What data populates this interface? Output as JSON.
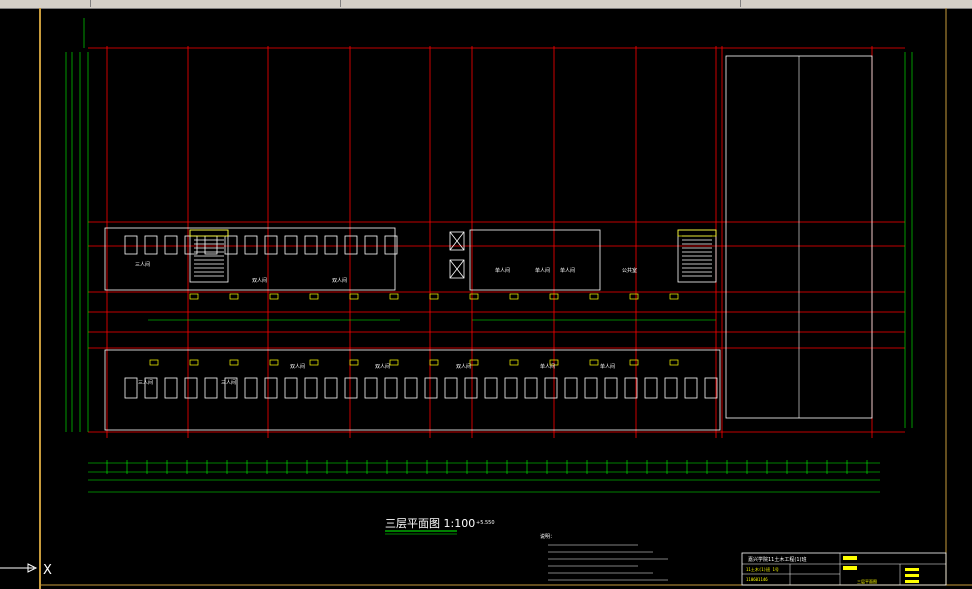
{
  "drawing": {
    "title": "三层平面图 1:100",
    "elevation": "+5.550",
    "rooms": {
      "double": "双人间",
      "single": "单人间",
      "triple": "三人间",
      "dorm": "公共室"
    },
    "notes_heading": "说明：",
    "title_block": {
      "project": "嘉兴学院11土木工程(1)班",
      "row1": "11土木(1)班 1号",
      "row2": "110601146",
      "sheet": "三层平面图"
    },
    "ucs_label": "X"
  },
  "colors": {
    "background": "#000000",
    "grid": "#ff0000",
    "dimension": "#00ff00",
    "walls": "#ffffff",
    "fixtures": "#ffff00",
    "border": "#c89b3c",
    "furniture": "#ff00ff"
  }
}
